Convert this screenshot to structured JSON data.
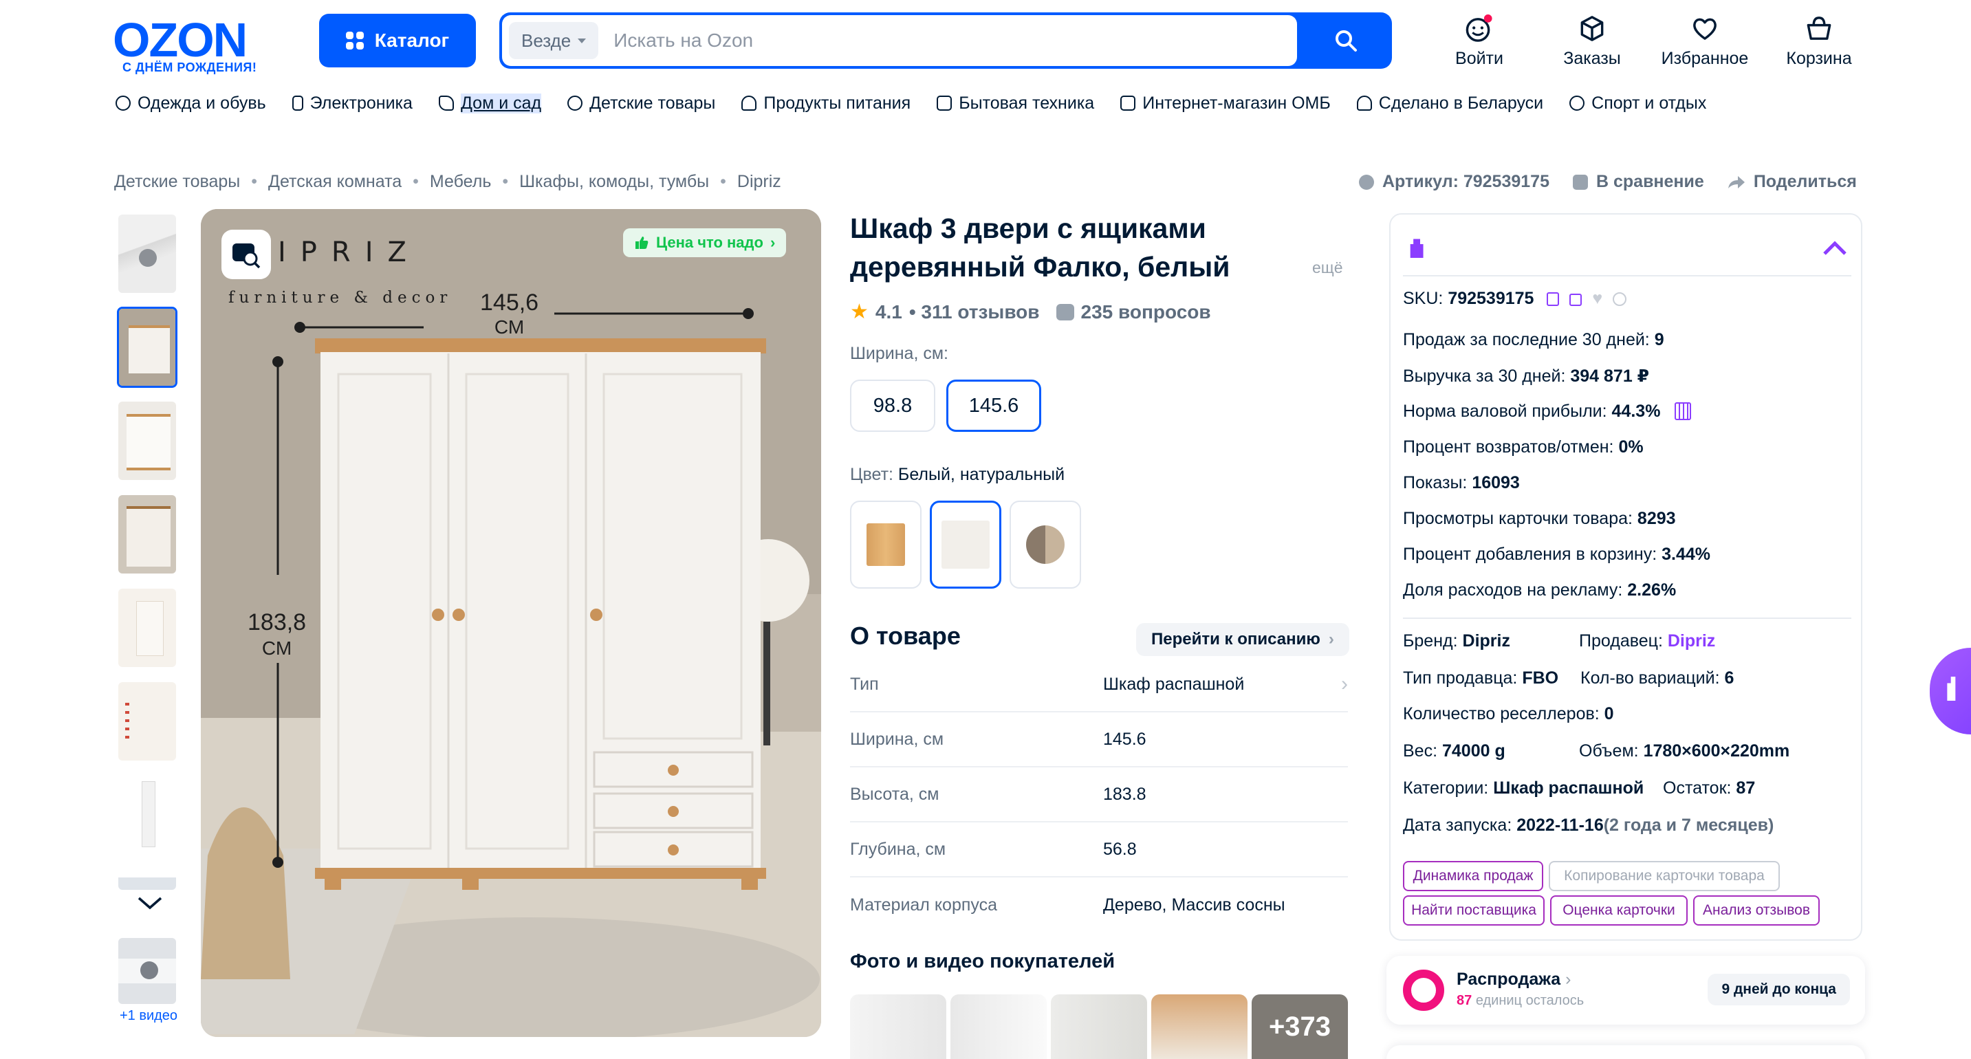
{
  "header": {
    "logo_text": "OZON",
    "logo_sub": "С ДНЁМ РОЖДЕНИЯ!",
    "catalog_label": "Каталог",
    "search_scope": "Везде",
    "search_placeholder": "Искать на Ozon",
    "actions": [
      {
        "label": "Войти",
        "icon": "smile-icon"
      },
      {
        "label": "Заказы",
        "icon": "box-icon"
      },
      {
        "label": "Избранное",
        "icon": "heart-icon"
      },
      {
        "label": "Корзина",
        "icon": "basket-icon"
      }
    ],
    "brand_color": "#005bff"
  },
  "nav": [
    {
      "label": "Одежда и обувь",
      "icon": "clothes-icon"
    },
    {
      "label": "Электроника",
      "icon": "phone-icon"
    },
    {
      "label": "Дом и сад",
      "icon": "plant-icon"
    },
    {
      "label": "Детские товары",
      "icon": "baby-icon"
    },
    {
      "label": "Продукты питания",
      "icon": "food-icon"
    },
    {
      "label": "Бытовая техника",
      "icon": "appliance-icon"
    },
    {
      "label": "Интернет-магазин ОМБ",
      "icon": "store-icon"
    },
    {
      "label": "Сделано в Беларуси",
      "icon": "belarus-icon"
    },
    {
      "label": "Спорт и отдых",
      "icon": "sport-icon"
    }
  ],
  "breadcrumbs": [
    "Детские товары",
    "Детская комната",
    "Мебель",
    "Шкафы, комоды, тумбы",
    "Dipriz"
  ],
  "top_actions": {
    "article": "Артикул: 792539175",
    "compare": "В сравнение",
    "share": "Поделиться"
  },
  "gallery": {
    "more_video": "+1 видео",
    "badge": "Цена что надо",
    "brand_text": "IPRIZ",
    "brand_sub": "furniture & decor",
    "dim_width": "145,6",
    "dim_width_unit": "СМ",
    "dim_height": "183,8",
    "dim_height_unit": "СМ"
  },
  "product": {
    "title": "Шкаф 3 двери с ящиками деревянный Фалко, белый",
    "more": "ещё",
    "rating": "4.1",
    "reviews": "• 311 отзывов",
    "questions": "235 вопросов",
    "width_label": "Ширина, см:",
    "widths": [
      "98.8",
      "145.6"
    ],
    "color_label": "Цвет:",
    "color_value": "Белый, натуральный",
    "about_title": "О товаре",
    "go_desc": "Перейти к описанию",
    "specs": [
      {
        "k": "Тип",
        "v": "Шкаф распашной"
      },
      {
        "k": "Ширина, см",
        "v": "145.6"
      },
      {
        "k": "Высота, см",
        "v": "183.8"
      },
      {
        "k": "Глубина, см",
        "v": "56.8"
      },
      {
        "k": "Материал корпуса",
        "v": "Дерево, Массив сосны"
      }
    ],
    "photos_title": "Фото и видео покупателей",
    "photos_more": "+373"
  },
  "panel": {
    "sku_label": "SKU:",
    "sku": "792539175",
    "rows": [
      {
        "k": "Продаж за последние 30 дней:",
        "v": "9"
      },
      {
        "k": "Выручка за 30 дней:",
        "v": "394 871 ₽"
      },
      {
        "k": "Норма валовой прибыли:",
        "v": "44.3%"
      },
      {
        "k": "Процент возвратов/отмен:",
        "v": "0%"
      },
      {
        "k": "Показы:",
        "v": "16093"
      },
      {
        "k": "Просмотры карточки товара:",
        "v": "8293"
      },
      {
        "k": "Процент добавления в корзину:",
        "v": "3.44%"
      },
      {
        "k": "Доля расходов на рекламу:",
        "v": "2.26%"
      }
    ],
    "brand_label": "Бренд:",
    "brand": "Dipriz",
    "seller_label": "Продавец:",
    "seller": "Dipriz",
    "sale_type_label": "Тип продавца:",
    "sale_type": "FBO",
    "variants_label": "Кол-во вариаций:",
    "variants": "6",
    "resellers_label": "Количество реселлеров:",
    "resellers": "0",
    "weight_label": "Вес:",
    "weight": "74000 g",
    "volume_label": "Объем:",
    "volume": "1780×600×220mm",
    "categories_label": "Категории:",
    "categories": "Шкаф распашной",
    "stock_label": "Остаток:",
    "stock": "87",
    "launch_label": "Дата запуска:",
    "launch": "2022-11-16",
    "launch_age": "(2 года и 7 месяцев)",
    "tags": [
      "Динамика продаж",
      "Копирование карточки товара",
      "Найти поставщика",
      "Оценка карточки",
      "Анализ отзывов"
    ]
  },
  "sale": {
    "title": "Распродажа",
    "count": "87",
    "subtitle": "единиц осталось",
    "days": "9 дней до конца"
  }
}
